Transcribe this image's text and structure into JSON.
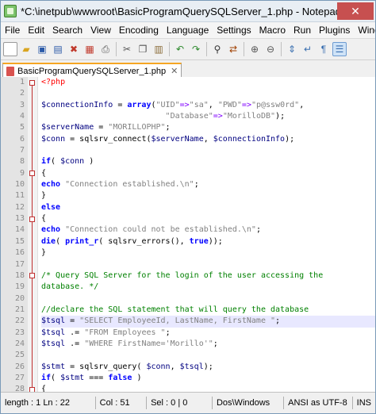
{
  "window": {
    "title": "*C:\\inetpub\\wwwroot\\BasicProgramQuerySQLServer_1.php - Notepad...",
    "close_glyph": "✕"
  },
  "menu": [
    "File",
    "Edit",
    "Search",
    "View",
    "Encoding",
    "Language",
    "Settings",
    "Macro",
    "Run",
    "Plugins",
    "Window",
    "?"
  ],
  "toolbar": {
    "icons": [
      "new-file-icon",
      "open-file-icon",
      "save-icon",
      "save-all-icon",
      "close-icon",
      "close-all-icon",
      "print-icon",
      "cut-icon",
      "copy-icon",
      "paste-icon",
      "undo-icon",
      "redo-icon",
      "find-icon",
      "replace-icon",
      "zoom-in-icon",
      "zoom-out-icon",
      "sync-scroll-icon",
      "word-wrap-icon",
      "show-all-chars-icon",
      "indent-guide-icon"
    ]
  },
  "tab": {
    "label": "BasicProgramQuerySQLServer_1.php",
    "close": "✕"
  },
  "lines": [
    {
      "n": "1",
      "html": "<span class=\"php\">&lt;?php</span>"
    },
    {
      "n": "2",
      "html": ""
    },
    {
      "n": "3",
      "html": "<span class=\"var\">$connectionInfo</span> = <span class=\"kw\">array</span>(<span class=\"str\">\"UID\"</span><span class=\"op\">=&gt;</span><span class=\"str\">\"sa\"</span>, <span class=\"str\">\"PWD\"</span><span class=\"op\">=&gt;</span><span class=\"str\">\"p@ssw0rd\"</span>,"
    },
    {
      "n": "4",
      "html": "                          <span class=\"str\">\"Database\"</span><span class=\"op\">=&gt;</span><span class=\"str\">\"MorilloDB\"</span>);"
    },
    {
      "n": "5",
      "html": "<span class=\"var\">$serverName</span> = <span class=\"str\">\"MORILLOPHP\"</span>;"
    },
    {
      "n": "6",
      "html": "<span class=\"var\">$conn</span> = sqlsrv_connect(<span class=\"var\">$serverName</span>, <span class=\"var\">$connectionInfo</span>);"
    },
    {
      "n": "7",
      "html": ""
    },
    {
      "n": "8",
      "html": "<span class=\"kw\">if</span>( <span class=\"var\">$conn</span> )"
    },
    {
      "n": "9",
      "html": "{"
    },
    {
      "n": "10",
      "html": "<span class=\"kw\">echo</span> <span class=\"str\">\"Connection established.\\n\"</span>;"
    },
    {
      "n": "11",
      "html": "}"
    },
    {
      "n": "12",
      "html": "<span class=\"kw\">else</span>"
    },
    {
      "n": "13",
      "html": "{"
    },
    {
      "n": "14",
      "html": "<span class=\"kw\">echo</span> <span class=\"str\">\"Connection could not be established.\\n\"</span>;"
    },
    {
      "n": "15",
      "html": "<span class=\"kw\">die</span>( <span class=\"kw\">print_r</span>( sqlsrv_errors(), <span class=\"kw\">true</span>));"
    },
    {
      "n": "16",
      "html": "}"
    },
    {
      "n": "17",
      "html": ""
    },
    {
      "n": "18",
      "html": "<span class=\"cmt\">/* Query SQL Server for the login of the user accessing the</span>"
    },
    {
      "n": "19",
      "html": "<span class=\"cmt\">database. */</span>"
    },
    {
      "n": "20",
      "html": ""
    },
    {
      "n": "21",
      "html": "<span class=\"cmt\">//declare the SQL statement that will query the database</span>"
    },
    {
      "n": "22",
      "html": "<span class=\"var\">$tsql</span> = <span class=\"str\">\"SELECT EmployeeId, LastName, FirstName \"</span>;"
    },
    {
      "n": "23",
      "html": "<span class=\"var\">$tsql</span> .= <span class=\"str\">\"FROM Employees \"</span>;"
    },
    {
      "n": "24",
      "html": "<span class=\"var\">$tsql</span> .= <span class=\"str\">\"WHERE FirstName='Morillo'\"</span>;"
    },
    {
      "n": "25",
      "html": ""
    },
    {
      "n": "26",
      "html": "<span class=\"var\">$stmt</span> = sqlsrv_query( <span class=\"var\">$conn</span>, <span class=\"var\">$tsql</span>);"
    },
    {
      "n": "27",
      "html": "<span class=\"kw\">if</span>( <span class=\"var\">$stmt</span> === <span class=\"kw\">false</span> )"
    },
    {
      "n": "28",
      "html": "{"
    }
  ],
  "status": {
    "length": "length : 1 Ln : 22",
    "col": "Col : 51",
    "sel": "Sel : 0 | 0",
    "eol": "Dos\\Windows",
    "encoding": "ANSI as UTF-8",
    "mode": "INS"
  }
}
